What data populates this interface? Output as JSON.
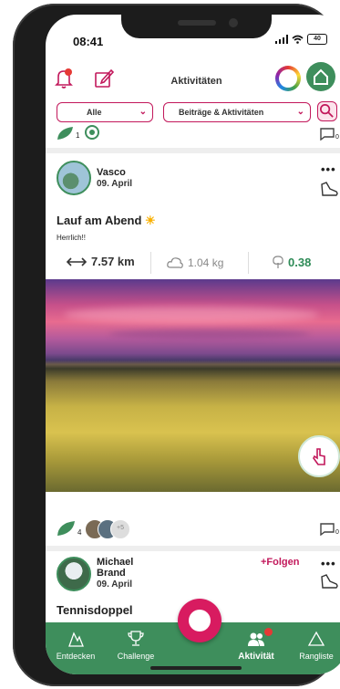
{
  "status": {
    "time": "08:41",
    "battery": "40"
  },
  "header": {
    "title": "Aktivitäten"
  },
  "filters": {
    "type_value": "Alle",
    "scope_value": "Beiträge & Aktivitäten"
  },
  "previous": {
    "likes_count": "1",
    "comments_count": "0"
  },
  "post1": {
    "user": "Vasco",
    "date": "09. April",
    "more": "•••",
    "title": "Lauf am Abend",
    "emoji": "☀",
    "description": "Herrlich!!",
    "distance": "7.57 km",
    "co2": "1.04 kg",
    "score": "0.38",
    "likes_count": "4",
    "extra_count": "+5",
    "comments_count": "0"
  },
  "post2": {
    "user_first": "Michael",
    "user_last": "Brand",
    "date": "09. April",
    "follow_label": "+Folgen",
    "more": "•••",
    "title": "Tennisdoppel"
  },
  "tabs": [
    {
      "label": "Entdecken",
      "icon": "discover-icon"
    },
    {
      "label": "Challenge",
      "icon": "trophy-icon"
    },
    {
      "label": "Aktivität",
      "icon": "people-icon",
      "badge": ""
    },
    {
      "label": "Rangliste",
      "icon": "triangle-icon"
    }
  ],
  "colors": {
    "primary": "#3e8e5c",
    "accent": "#c2185b",
    "fab": "#d81b60"
  }
}
